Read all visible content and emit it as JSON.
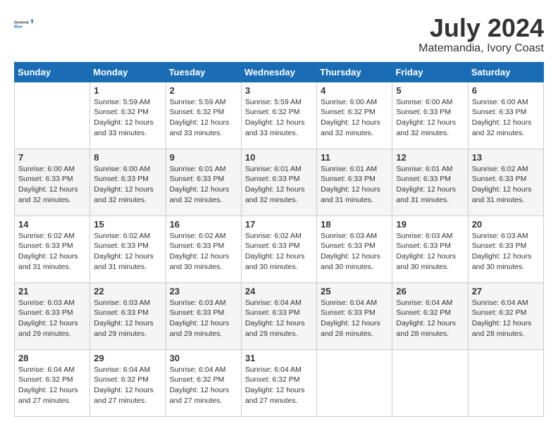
{
  "header": {
    "logo_general": "General",
    "logo_blue": "Blue",
    "title": "July 2024",
    "location": "Matemandia, Ivory Coast"
  },
  "columns": [
    "Sunday",
    "Monday",
    "Tuesday",
    "Wednesday",
    "Thursday",
    "Friday",
    "Saturday"
  ],
  "weeks": [
    [
      {
        "day": "",
        "info": ""
      },
      {
        "day": "1",
        "info": "Sunrise: 5:59 AM\nSunset: 6:32 PM\nDaylight: 12 hours\nand 33 minutes."
      },
      {
        "day": "2",
        "info": "Sunrise: 5:59 AM\nSunset: 6:32 PM\nDaylight: 12 hours\nand 33 minutes."
      },
      {
        "day": "3",
        "info": "Sunrise: 5:59 AM\nSunset: 6:32 PM\nDaylight: 12 hours\nand 33 minutes."
      },
      {
        "day": "4",
        "info": "Sunrise: 6:00 AM\nSunset: 6:32 PM\nDaylight: 12 hours\nand 32 minutes."
      },
      {
        "day": "5",
        "info": "Sunrise: 6:00 AM\nSunset: 6:33 PM\nDaylight: 12 hours\nand 32 minutes."
      },
      {
        "day": "6",
        "info": "Sunrise: 6:00 AM\nSunset: 6:33 PM\nDaylight: 12 hours\nand 32 minutes."
      }
    ],
    [
      {
        "day": "7",
        "info": "Sunrise: 6:00 AM\nSunset: 6:33 PM\nDaylight: 12 hours\nand 32 minutes."
      },
      {
        "day": "8",
        "info": "Sunrise: 6:00 AM\nSunset: 6:33 PM\nDaylight: 12 hours\nand 32 minutes."
      },
      {
        "day": "9",
        "info": "Sunrise: 6:01 AM\nSunset: 6:33 PM\nDaylight: 12 hours\nand 32 minutes."
      },
      {
        "day": "10",
        "info": "Sunrise: 6:01 AM\nSunset: 6:33 PM\nDaylight: 12 hours\nand 32 minutes."
      },
      {
        "day": "11",
        "info": "Sunrise: 6:01 AM\nSunset: 6:33 PM\nDaylight: 12 hours\nand 31 minutes."
      },
      {
        "day": "12",
        "info": "Sunrise: 6:01 AM\nSunset: 6:33 PM\nDaylight: 12 hours\nand 31 minutes."
      },
      {
        "day": "13",
        "info": "Sunrise: 6:02 AM\nSunset: 6:33 PM\nDaylight: 12 hours\nand 31 minutes."
      }
    ],
    [
      {
        "day": "14",
        "info": "Sunrise: 6:02 AM\nSunset: 6:33 PM\nDaylight: 12 hours\nand 31 minutes."
      },
      {
        "day": "15",
        "info": "Sunrise: 6:02 AM\nSunset: 6:33 PM\nDaylight: 12 hours\nand 31 minutes."
      },
      {
        "day": "16",
        "info": "Sunrise: 6:02 AM\nSunset: 6:33 PM\nDaylight: 12 hours\nand 30 minutes."
      },
      {
        "day": "17",
        "info": "Sunrise: 6:02 AM\nSunset: 6:33 PM\nDaylight: 12 hours\nand 30 minutes."
      },
      {
        "day": "18",
        "info": "Sunrise: 6:03 AM\nSunset: 6:33 PM\nDaylight: 12 hours\nand 30 minutes."
      },
      {
        "day": "19",
        "info": "Sunrise: 6:03 AM\nSunset: 6:33 PM\nDaylight: 12 hours\nand 30 minutes."
      },
      {
        "day": "20",
        "info": "Sunrise: 6:03 AM\nSunset: 6:33 PM\nDaylight: 12 hours\nand 30 minutes."
      }
    ],
    [
      {
        "day": "21",
        "info": "Sunrise: 6:03 AM\nSunset: 6:33 PM\nDaylight: 12 hours\nand 29 minutes."
      },
      {
        "day": "22",
        "info": "Sunrise: 6:03 AM\nSunset: 6:33 PM\nDaylight: 12 hours\nand 29 minutes."
      },
      {
        "day": "23",
        "info": "Sunrise: 6:03 AM\nSunset: 6:33 PM\nDaylight: 12 hours\nand 29 minutes."
      },
      {
        "day": "24",
        "info": "Sunrise: 6:04 AM\nSunset: 6:33 PM\nDaylight: 12 hours\nand 29 minutes."
      },
      {
        "day": "25",
        "info": "Sunrise: 6:04 AM\nSunset: 6:33 PM\nDaylight: 12 hours\nand 28 minutes."
      },
      {
        "day": "26",
        "info": "Sunrise: 6:04 AM\nSunset: 6:32 PM\nDaylight: 12 hours\nand 28 minutes."
      },
      {
        "day": "27",
        "info": "Sunrise: 6:04 AM\nSunset: 6:32 PM\nDaylight: 12 hours\nand 28 minutes."
      }
    ],
    [
      {
        "day": "28",
        "info": "Sunrise: 6:04 AM\nSunset: 6:32 PM\nDaylight: 12 hours\nand 27 minutes."
      },
      {
        "day": "29",
        "info": "Sunrise: 6:04 AM\nSunset: 6:32 PM\nDaylight: 12 hours\nand 27 minutes."
      },
      {
        "day": "30",
        "info": "Sunrise: 6:04 AM\nSunset: 6:32 PM\nDaylight: 12 hours\nand 27 minutes."
      },
      {
        "day": "31",
        "info": "Sunrise: 6:04 AM\nSunset: 6:32 PM\nDaylight: 12 hours\nand 27 minutes."
      },
      {
        "day": "",
        "info": ""
      },
      {
        "day": "",
        "info": ""
      },
      {
        "day": "",
        "info": ""
      }
    ]
  ]
}
